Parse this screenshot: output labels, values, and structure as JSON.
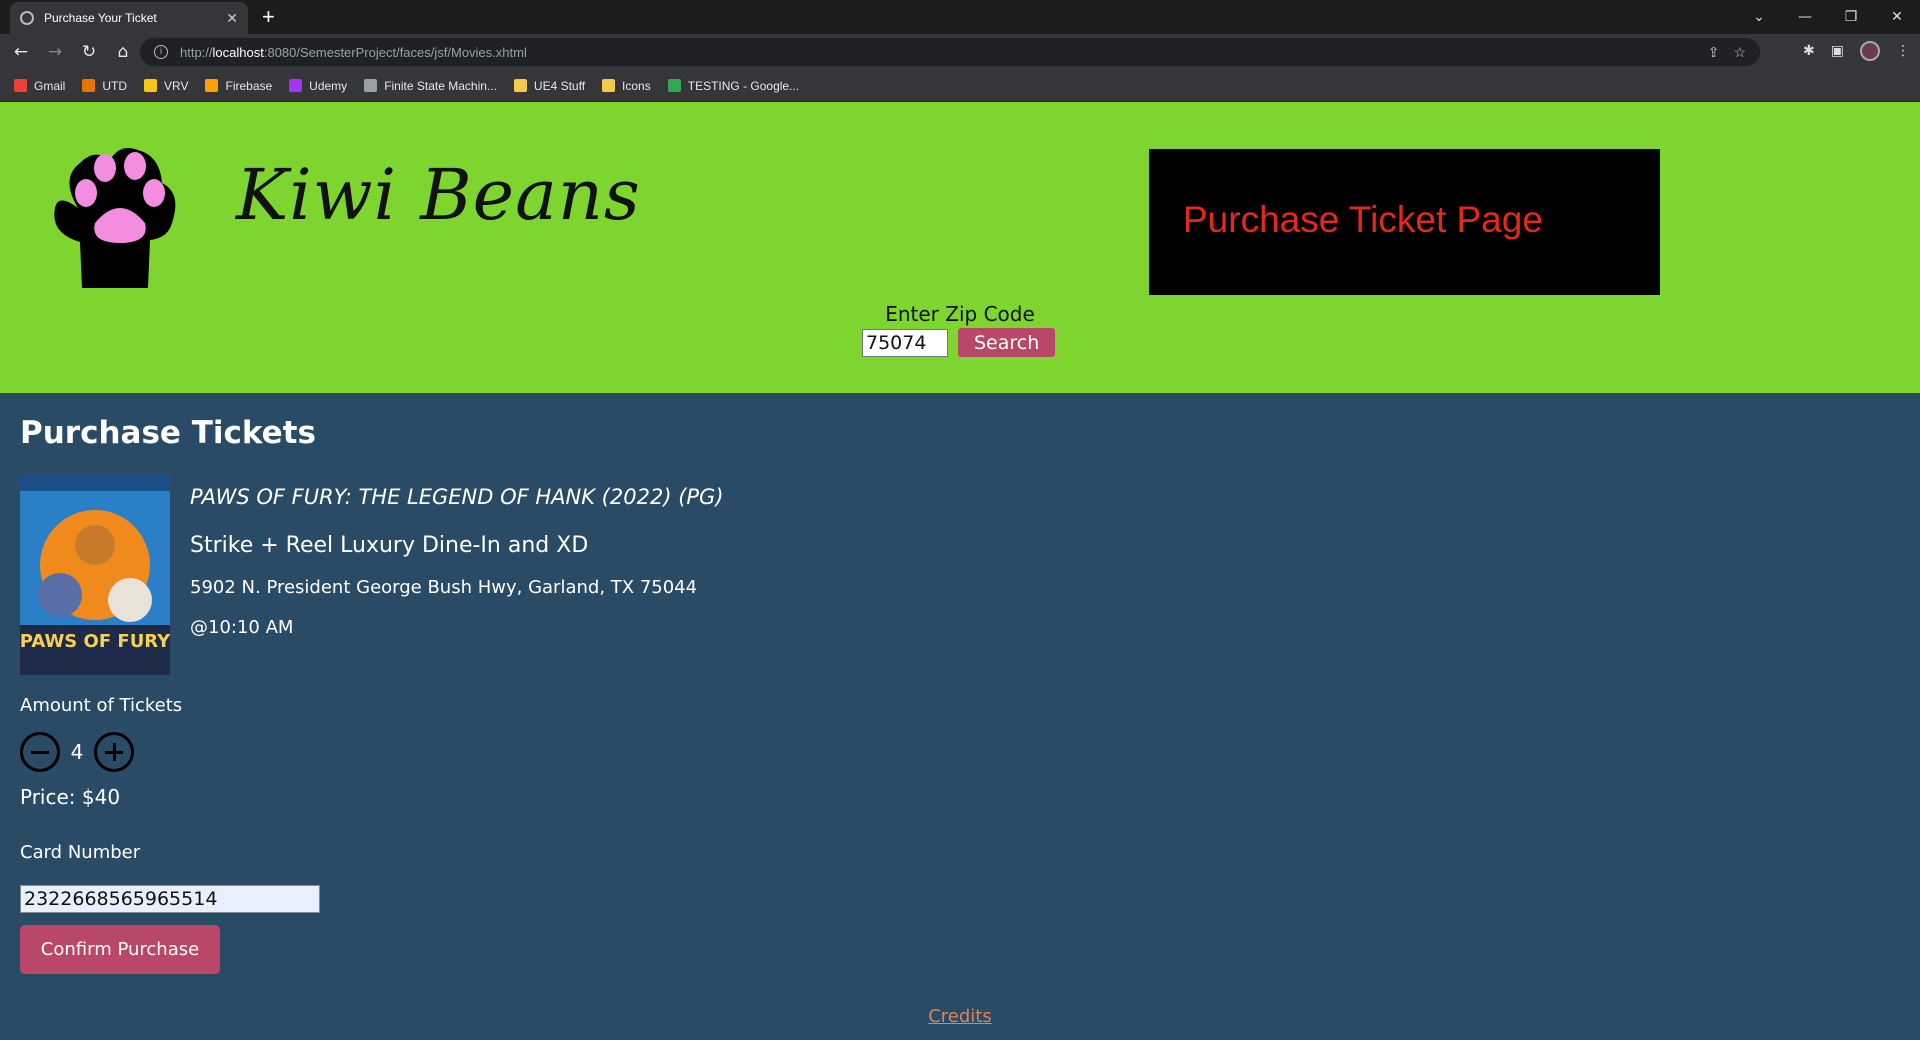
{
  "browser": {
    "tab_title": "Purchase Your Ticket",
    "new_tab": "+",
    "url_scheme_host_prefix": "http://",
    "url_host": "localhost",
    "url_rest": ":8080/SemesterProject/faces/jsf/Movies.xhtml",
    "bookmarks": [
      {
        "label": "Gmail",
        "icon": "gmail-icon",
        "color": "#ea4335"
      },
      {
        "label": "UTD",
        "icon": "utd-icon",
        "color": "#e87500"
      },
      {
        "label": "VRV",
        "icon": "vrv-icon",
        "color": "#f5c518"
      },
      {
        "label": "Firebase",
        "icon": "firebase-icon",
        "color": "#ffa000"
      },
      {
        "label": "Udemy",
        "icon": "udemy-icon",
        "color": "#a435f0"
      },
      {
        "label": "Finite State Machin...",
        "icon": "globe-icon",
        "color": "#9aa0a6"
      },
      {
        "label": "UE4 Stuff",
        "icon": "folder-icon",
        "color": "#f2c94c"
      },
      {
        "label": "Icons",
        "icon": "folder-icon",
        "color": "#f2c94c"
      },
      {
        "label": "TESTING - Google...",
        "icon": "google-drive-icon",
        "color": "#34a853"
      }
    ]
  },
  "header": {
    "brand": "Kiwi Beans",
    "badge": "Purchase Ticket Page",
    "zip_label": "Enter Zip Code",
    "zip_value": "75074",
    "search_label": "Search",
    "bg_color": "#7ed530"
  },
  "main": {
    "title": "Purchase Tickets",
    "movie_title": "PAWS OF FURY: THE LEGEND OF HANK (2022) (PG)",
    "theater": "Strike + Reel Luxury Dine-In and XD",
    "address": "5902 N. President George Bush Hwy, Garland, TX 75044",
    "showtime": "@10:10 AM",
    "poster_text": "PAWS OF FURY",
    "qty_label": "Amount of Tickets",
    "qty_value": "4",
    "price": "Price: $40",
    "card_label": "Card Number",
    "card_value": "2322668565965514",
    "confirm_label": "Confirm Purchase",
    "bg_color": "#294b66",
    "accent_color": "#b8476a"
  },
  "footer": {
    "credits": "Credits"
  }
}
